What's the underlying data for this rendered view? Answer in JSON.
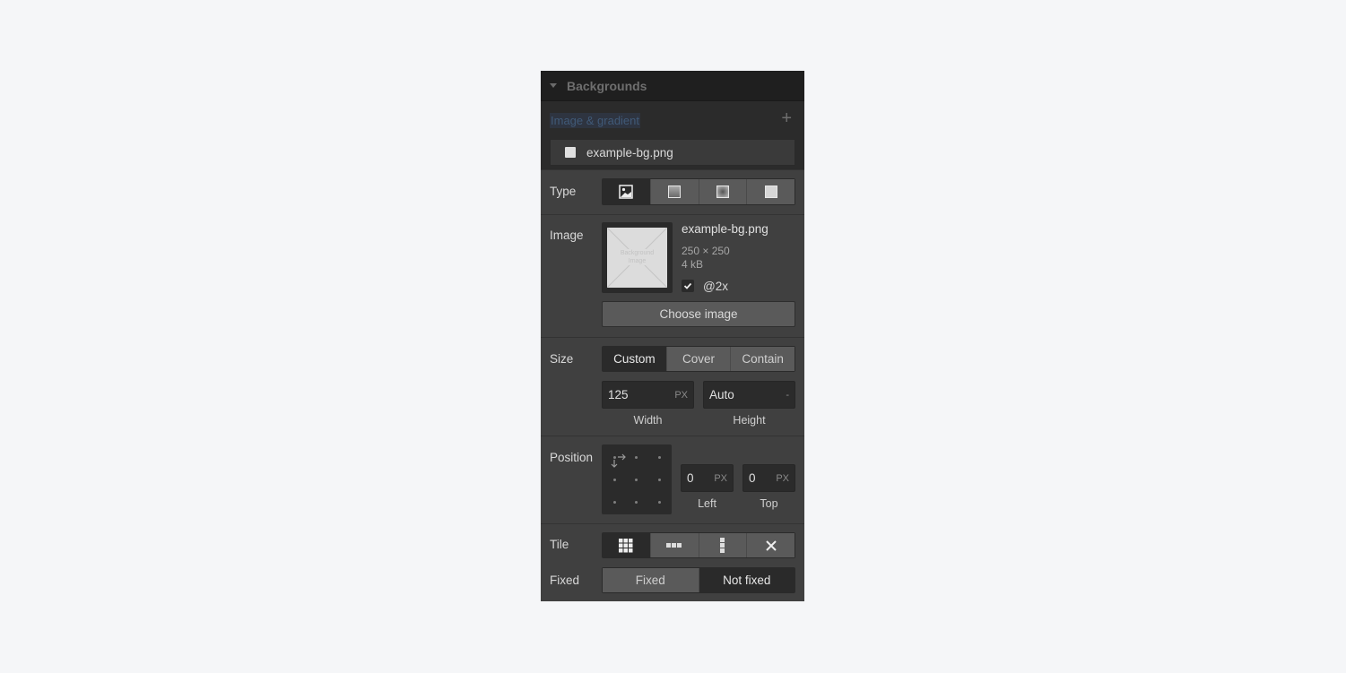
{
  "panel": {
    "title": "Backgrounds",
    "layers_label": "Image & gradient",
    "add_icon": "plus-icon",
    "layer_name": "example-bg.png"
  },
  "type": {
    "label": "Type",
    "options": [
      {
        "icon": "image-icon",
        "name": "Image",
        "active": true
      },
      {
        "icon": "linear-gradient-icon",
        "name": "Linear gradient",
        "active": false
      },
      {
        "icon": "radial-gradient-icon",
        "name": "Radial gradient",
        "active": false
      },
      {
        "icon": "color-overlay-icon",
        "name": "Color overlay",
        "active": false
      }
    ]
  },
  "image": {
    "label": "Image",
    "thumbnail_text": "Background Image",
    "filename": "example-bg.png",
    "dimensions": "250 × 250",
    "filesize": "4 kB",
    "retina_label": "@2x",
    "retina_checked": true,
    "choose_label": "Choose image"
  },
  "size": {
    "label": "Size",
    "options": [
      "Custom",
      "Cover",
      "Contain"
    ],
    "selected": "Custom",
    "width_value": "125",
    "width_unit": "PX",
    "width_label": "Width",
    "height_value": "Auto",
    "height_unit": "-",
    "height_label": "Height"
  },
  "position": {
    "label": "Position",
    "left_value": "0",
    "left_unit": "PX",
    "left_label": "Left",
    "top_value": "0",
    "top_unit": "PX",
    "top_label": "Top"
  },
  "tile": {
    "label": "Tile",
    "options": [
      {
        "icon": "tile-repeat-icon",
        "name": "Repeat",
        "active": true
      },
      {
        "icon": "tile-repeat-x-icon",
        "name": "Repeat horizontally",
        "active": false
      },
      {
        "icon": "tile-repeat-y-icon",
        "name": "Repeat vertically",
        "active": false
      },
      {
        "icon": "no-repeat-icon",
        "name": "Don't repeat",
        "active": false
      }
    ]
  },
  "fixed": {
    "label": "Fixed",
    "options": [
      "Fixed",
      "Not fixed"
    ],
    "selected": "Not fixed"
  }
}
